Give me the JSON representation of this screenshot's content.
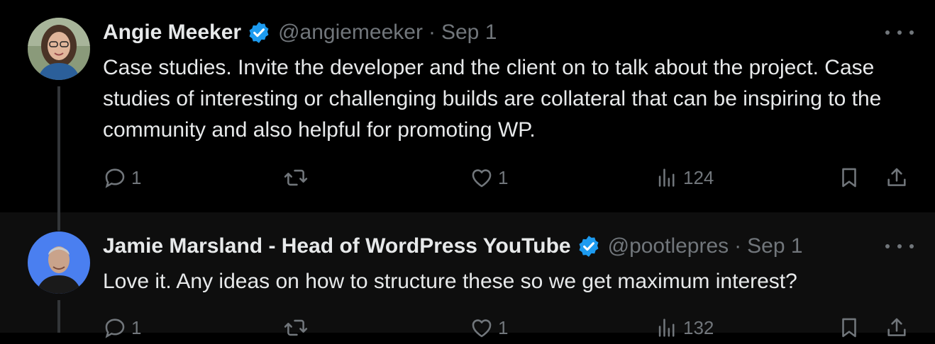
{
  "tweets": [
    {
      "name": "Angie Meeker",
      "handle": "@angiemeeker",
      "separator": "·",
      "date": "Sep 1",
      "text": "Case studies. Invite the developer and the client on to talk about the project. Case studies of interesting or challenging builds are collateral that can be inspiring to the community and also helpful for promoting WP.",
      "replies": "1",
      "reposts": "",
      "likes": "1",
      "views": "124"
    },
    {
      "name": "Jamie Marsland - Head of WordPress YouTube",
      "handle": "@pootlepres",
      "separator": "·",
      "date": "Sep 1",
      "text": "Love it. Any ideas on how to structure these so we get maximum interest?",
      "replies": "1",
      "reposts": "",
      "likes": "1",
      "views": "132"
    }
  ],
  "colors": {
    "background": "#000000",
    "reply_background": "#0e0e0e",
    "text": "#e7e9ea",
    "muted": "#71767b",
    "verified": "#1d9bf0"
  },
  "icons": [
    "verified-badge-icon",
    "more-icon",
    "reply-icon",
    "repost-icon",
    "like-icon",
    "views-icon",
    "bookmark-icon",
    "share-icon"
  ]
}
